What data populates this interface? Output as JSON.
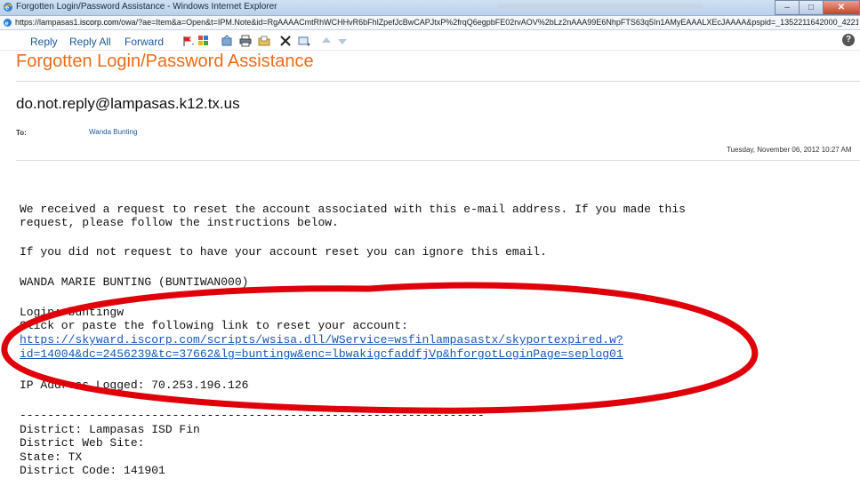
{
  "window": {
    "title": "Forgotten Login/Password Assistance - Windows Internet Explorer",
    "url_prefix": "https://lampasas1.",
    "url_domain": "iscorp.com",
    "url_rest": "/owa/?ae=Item&a=Open&t=IPM.Note&id=RgAAAACmtRhWCHHvR6bFhlZpefJcBwCAPJtxP%2frqQ6egpbFE02rvAOV%2bLz2nAAA99E6NhpFTS63q5In1AMyEAAALXEcJAAAA&pspid=_1352211642000_4221..."
  },
  "toolbar": {
    "reply_label": "Reply",
    "reply_all_label": "Reply All",
    "forward_label": "Forward",
    "help_glyph": "?"
  },
  "email": {
    "subject": "Forgotten Login/Password Assistance",
    "sender": "do.not.reply@lampasas.k12.tx.us",
    "to_label": "To:",
    "to_value": "Wanda Bunting",
    "date": "Tuesday, November 06, 2012 10:27 AM",
    "line_received_1": "We received a request to reset the account associated with this e-mail address. If you made this",
    "line_received_2": "request, please follow the instructions below.",
    "line_ignore": "If you did not request to have your account reset you can ignore this email.",
    "line_name": "WANDA MARIE BUNTING (BUNTIWAN000)",
    "line_login": "Login: buntingw",
    "line_click": "Click or paste the following link to reset your account:",
    "link_1": "https://skyward.iscorp.com/scripts/wsisa.dll/WService=wsfinlampasastx/skyportexpired.w?",
    "link_2": "id=14004&dc=2456239&tc=37662&lg=buntingw&enc=lbwakigcfaddfjVp&hforgotLoginPage=seplog01",
    "line_ip": "IP Address Logged: 70.253.196.126",
    "line_dashes": "-------------------------------------------------------------------",
    "line_district": "District: Lampasas ISD Fin",
    "line_website": "District Web Site:",
    "line_state": "State: TX",
    "line_code": "District Code: 141901"
  },
  "colors": {
    "subject": "#ee6b17",
    "link": "#1a56b8",
    "annotation": "#e0000a"
  },
  "icons": [
    "ie-logo-icon",
    "page-icon",
    "flag-icon",
    "categories-icon",
    "move-icon",
    "print-icon",
    "open-folder-icon",
    "delete-icon",
    "reply-arrow-icon",
    "up-arrow-icon",
    "down-arrow-icon",
    "help-icon"
  ]
}
